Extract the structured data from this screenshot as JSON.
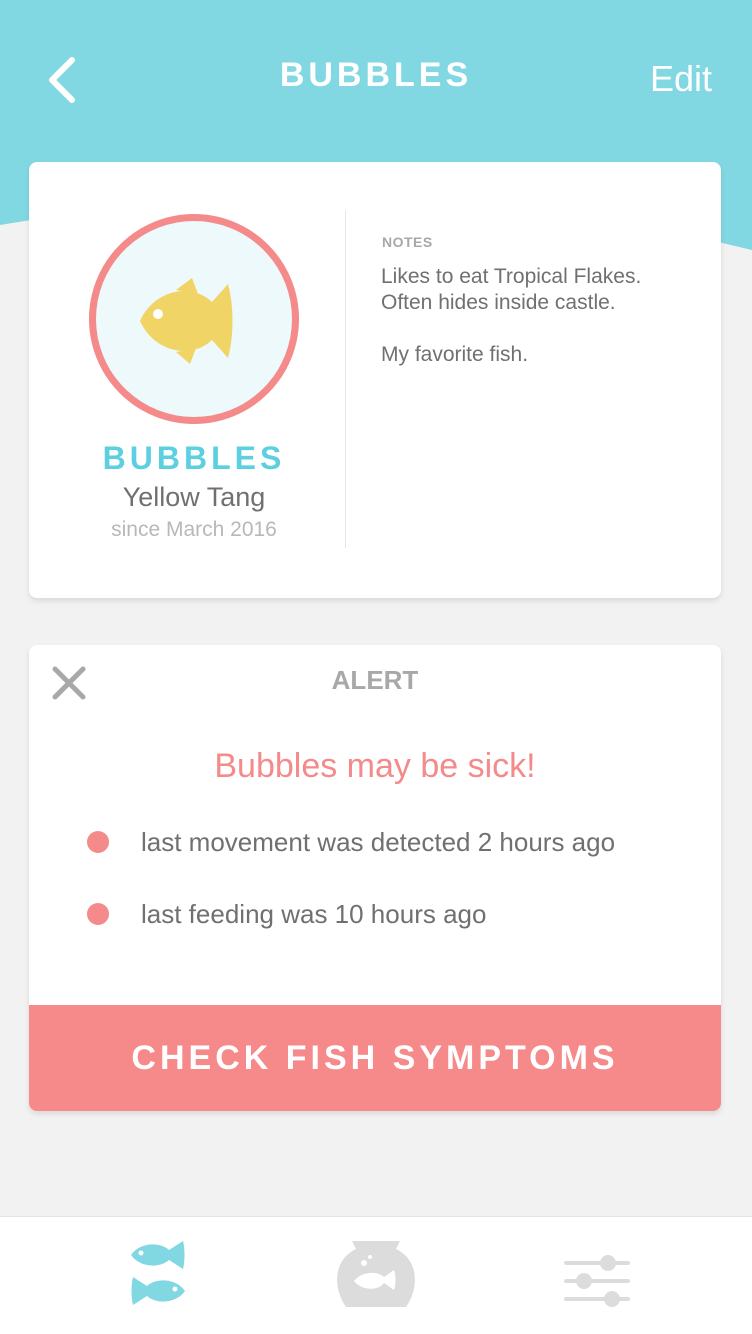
{
  "header": {
    "title": "BUBBLES",
    "edit_label": "Edit",
    "back_icon": "chevron-left-icon"
  },
  "profile": {
    "name": "BUBBLES",
    "species": "Yellow Tang",
    "since": "since March 2016",
    "avatar_icon": "fish-icon",
    "notes": {
      "label": "NOTES",
      "lines": [
        "Likes  to eat Tropical Flakes.",
        "Often hides inside castle."
      ],
      "extra": "My favorite fish."
    }
  },
  "alert": {
    "label": "ALERT",
    "headline": "Bubbles may be sick!",
    "items": [
      "last movement was detected 2 hours ago",
      "last feeding was 10 hours ago"
    ],
    "button_label": "CHECK FISH SYMPTOMS",
    "close_icon": "close-icon"
  },
  "nav": {
    "items": [
      {
        "icon": "fish-pair-icon",
        "active": true
      },
      {
        "icon": "fishbowl-icon",
        "active": false
      },
      {
        "icon": "sliders-icon",
        "active": false
      }
    ]
  },
  "colors": {
    "header": "#82d8e2",
    "accent": "#5ccfe0",
    "alert": "#f48a8a",
    "fish": "#f0d466",
    "background": "#f2f2f2"
  }
}
